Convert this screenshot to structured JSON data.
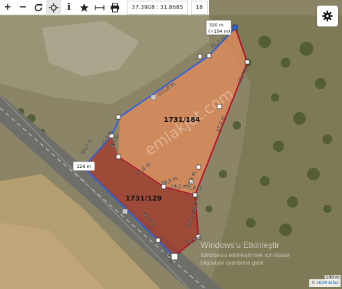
{
  "toolbar": {
    "buttons": [
      {
        "name": "zoom-in-button",
        "glyph": "+"
      },
      {
        "name": "zoom-out-button",
        "glyph": "−"
      },
      {
        "name": "refresh-button",
        "glyph": "refresh"
      },
      {
        "name": "locate-button",
        "glyph": "crosshair"
      },
      {
        "name": "info-button",
        "glyph": "i"
      },
      {
        "name": "favorite-button",
        "glyph": "star"
      },
      {
        "name": "measure-button",
        "glyph": "measure"
      },
      {
        "name": "print-button",
        "glyph": "printer"
      }
    ],
    "coordinates": "37.3908 : 31.8685",
    "zoom": "18"
  },
  "map": {
    "elevation_top": "320 m",
    "elevation_top_diff": "(+194 m)",
    "elevation_left": "126 m",
    "parcels": [
      {
        "id": "1731/184",
        "color": "#e08a5a"
      },
      {
        "id": "1731/129",
        "color": "#b0493a"
      }
    ],
    "edge_labels": [
      "12,3 m",
      "8,4 m",
      "42,6 m",
      "131,8 m",
      "66,9 m",
      "14,1 m",
      "1,6 m",
      "51,5 m",
      "42,9 m",
      "22,4 m",
      "70,3 m",
      "19,3 m",
      "53,4 m",
      "18,6 m",
      "21,9 m",
      "64,3 m",
      "100,8 m"
    ],
    "watermark": "emlakjet.com",
    "windows_watermark": [
      "Windows'u Etkinleştir",
      "Windows'u etkinleştirmek için kişisel",
      "bilgisayar ayarlarına gidin."
    ],
    "scale_label": "100 m",
    "attribution": "HGM Atlas"
  },
  "colors": {
    "boundary_red": "#b0122b",
    "boundary_blue": "#2f5fe0",
    "parcel_top": "#e08a5a",
    "parcel_bottom": "#a13a2c"
  }
}
